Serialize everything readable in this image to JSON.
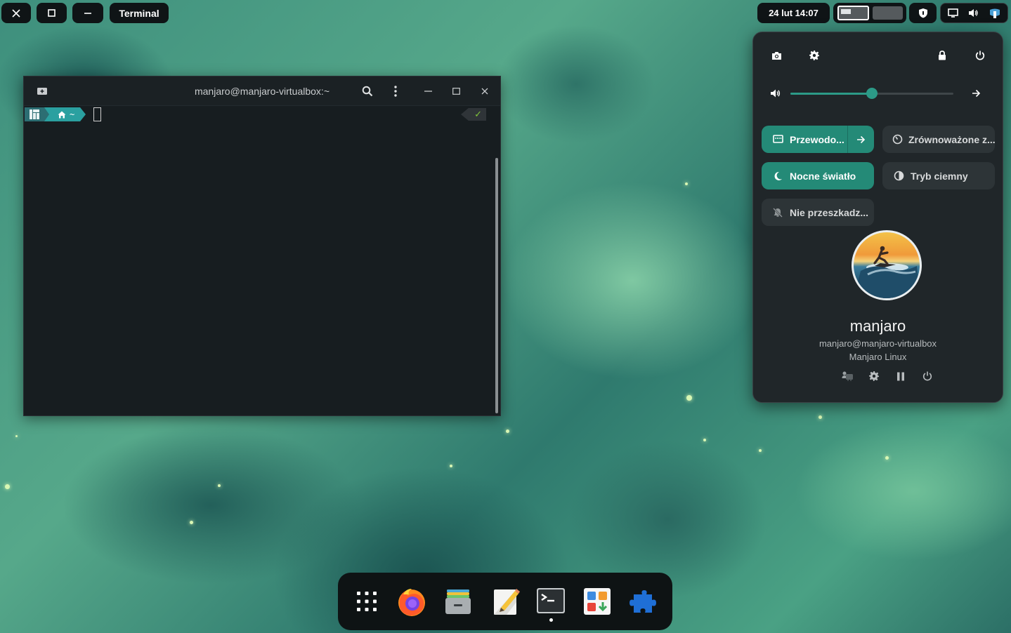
{
  "topbar": {
    "close_label": "×",
    "maximize_label": "□",
    "minimize_label": "–",
    "app_name": "Terminal",
    "clock": "24 lut  14:07"
  },
  "terminal": {
    "title": "manjaro@manjaro-virtualbox:~",
    "prompt_home": "~",
    "status_check": "✓"
  },
  "quick_settings": {
    "volume_level": 0.5,
    "toggles": {
      "wired": {
        "label": "Przewodo..."
      },
      "power_profile": {
        "label": "Zrównoważone z..."
      },
      "night_light": {
        "label": "Nocne światło"
      },
      "dark_mode": {
        "label": "Tryb ciemny"
      },
      "dnd": {
        "label": "Nie przeszkadz..."
      }
    },
    "user": {
      "name": "manjaro",
      "host": "manjaro@manjaro-virtualbox",
      "distro": "Manjaro Linux"
    }
  },
  "colors": {
    "accent": "#248a77",
    "panel_bg": "#202629",
    "terminal_bg": "#171d20",
    "dock_bg": "#0e1314"
  },
  "dock": {
    "items": [
      {
        "name": "app-grid-icon"
      },
      {
        "name": "firefox-icon"
      },
      {
        "name": "files-icon"
      },
      {
        "name": "text-editor-icon"
      },
      {
        "name": "terminal-icon",
        "running": true
      },
      {
        "name": "software-center-icon"
      },
      {
        "name": "extensions-icon"
      }
    ]
  }
}
